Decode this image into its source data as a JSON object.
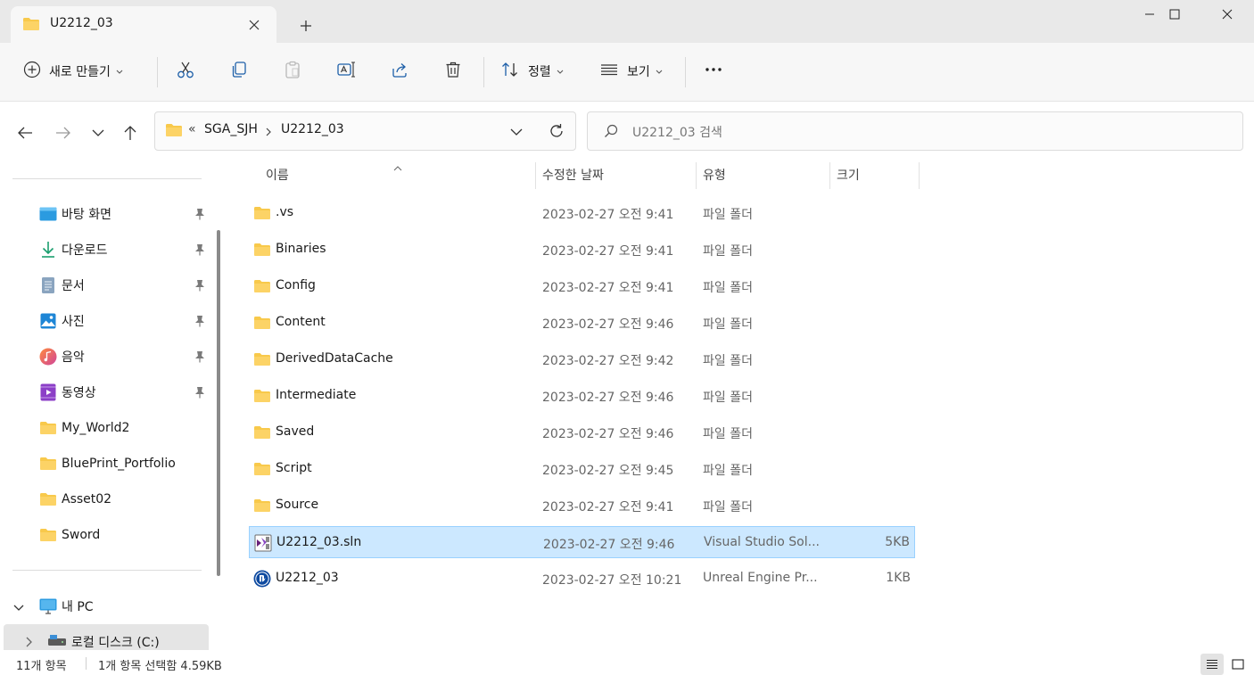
{
  "tab": {
    "title": "U2212_03"
  },
  "toolbar": {
    "new_label": "새로 만들기",
    "sort_label": "정렬",
    "view_label": "보기"
  },
  "address": {
    "overflow": "«",
    "segments": [
      "SGA_SJH",
      "U2212_03"
    ]
  },
  "search": {
    "placeholder": "U2212_03 검색"
  },
  "sidebar": {
    "quick_access": [
      {
        "label": "바탕 화면",
        "icon": "desktop-icon",
        "pinned": true
      },
      {
        "label": "다운로드",
        "icon": "download-icon",
        "pinned": true
      },
      {
        "label": "문서",
        "icon": "document-icon",
        "pinned": true
      },
      {
        "label": "사진",
        "icon": "pictures-icon",
        "pinned": true
      },
      {
        "label": "음악",
        "icon": "music-icon",
        "pinned": true
      },
      {
        "label": "동영상",
        "icon": "video-icon",
        "pinned": true
      },
      {
        "label": "My_World2",
        "icon": "folder-icon",
        "pinned": false
      },
      {
        "label": "BluePrint_Portfolio",
        "icon": "folder-icon",
        "pinned": false
      },
      {
        "label": "Asset02",
        "icon": "folder-icon",
        "pinned": false
      },
      {
        "label": "Sword",
        "icon": "folder-icon",
        "pinned": false
      }
    ],
    "this_pc": {
      "label": "내 PC"
    },
    "drive": {
      "label": "로컬 디스크 (C:)"
    }
  },
  "columns": {
    "name": "이름",
    "date": "수정한 날짜",
    "type": "유형",
    "size": "크기"
  },
  "files": [
    {
      "name": ".vs",
      "date": "2023-02-27 오전 9:41",
      "type": "파일 폴더",
      "size": "",
      "icon": "folder-icon",
      "selected": false
    },
    {
      "name": "Binaries",
      "date": "2023-02-27 오전 9:41",
      "type": "파일 폴더",
      "size": "",
      "icon": "folder-icon",
      "selected": false
    },
    {
      "name": "Config",
      "date": "2023-02-27 오전 9:41",
      "type": "파일 폴더",
      "size": "",
      "icon": "folder-icon",
      "selected": false
    },
    {
      "name": "Content",
      "date": "2023-02-27 오전 9:46",
      "type": "파일 폴더",
      "size": "",
      "icon": "folder-icon",
      "selected": false
    },
    {
      "name": "DerivedDataCache",
      "date": "2023-02-27 오전 9:42",
      "type": "파일 폴더",
      "size": "",
      "icon": "folder-icon",
      "selected": false
    },
    {
      "name": "Intermediate",
      "date": "2023-02-27 오전 9:46",
      "type": "파일 폴더",
      "size": "",
      "icon": "folder-icon",
      "selected": false
    },
    {
      "name": "Saved",
      "date": "2023-02-27 오전 9:46",
      "type": "파일 폴더",
      "size": "",
      "icon": "folder-icon",
      "selected": false
    },
    {
      "name": "Script",
      "date": "2023-02-27 오전 9:45",
      "type": "파일 폴더",
      "size": "",
      "icon": "folder-icon",
      "selected": false
    },
    {
      "name": "Source",
      "date": "2023-02-27 오전 9:41",
      "type": "파일 폴더",
      "size": "",
      "icon": "folder-icon",
      "selected": false
    },
    {
      "name": "U2212_03.sln",
      "date": "2023-02-27 오전 9:46",
      "type": "Visual Studio Sol...",
      "size": "5KB",
      "icon": "visual-studio-solution-icon",
      "selected": true
    },
    {
      "name": "U2212_03",
      "date": "2023-02-27 오전 10:21",
      "type": "Unreal Engine Pr...",
      "size": "1KB",
      "icon": "unreal-engine-icon",
      "selected": false
    }
  ],
  "status": {
    "item_count": "11개 항목",
    "selection": "1개 항목 선택함 4.59KB"
  },
  "colors": {
    "folder": "#f8c94b",
    "selection": "#cce8ff",
    "selection_border": "#99d1ff",
    "accent": "#0067c0"
  }
}
